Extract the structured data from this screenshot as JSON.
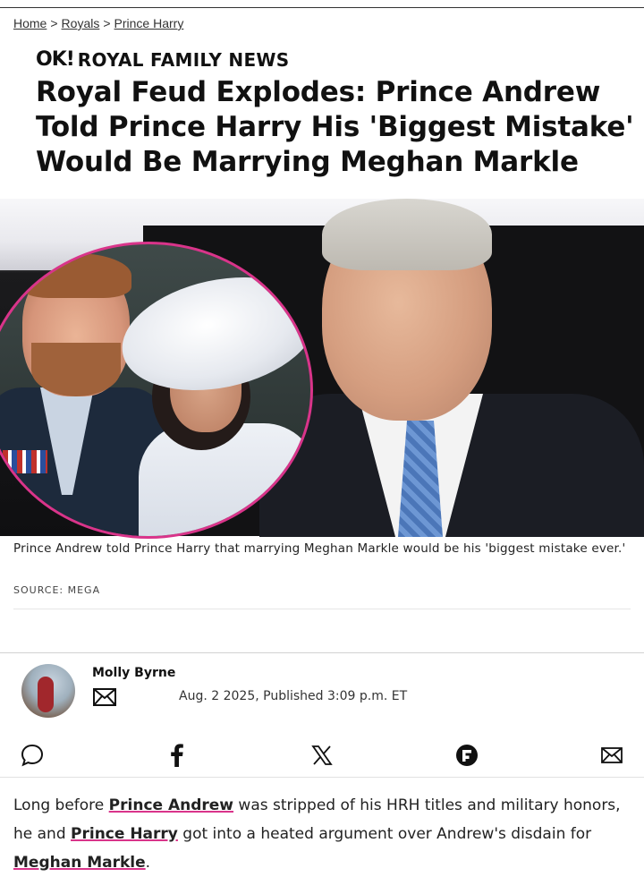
{
  "breadcrumb": {
    "home": "Home",
    "sep": ">",
    "royals": "Royals",
    "current": "Prince Harry"
  },
  "brand": {
    "logo": "OK!",
    "section": "ROYAL FAMILY NEWS"
  },
  "article": {
    "headline": "Royal Feud Explodes: Prince Andrew Told Prince Harry His 'Biggest Mistake' Would Be Marrying Meghan Markle",
    "caption": "Prince Andrew told Prince Harry that marrying Meghan Markle would be his 'biggest mistake ever.'",
    "source": "SOURCE: MEGA"
  },
  "author": {
    "name": "Molly Byrne",
    "published": "Aug. 2 2025, Published 3:09 p.m. ET"
  },
  "share_icons": [
    "comment-icon",
    "facebook-icon",
    "x-icon",
    "flipboard-icon",
    "email-icon"
  ],
  "body": {
    "p1_text1": "Long before ",
    "p1_link1": "Prince Andrew",
    "p1_text2": " was stripped of his HRH titles and military honors, he and ",
    "p1_link2": "Prince Harry",
    "p1_text3": " got into a heated argument over Andrew's disdain for ",
    "p1_link3": "Meghan Markle",
    "p1_text4": "."
  },
  "colors": {
    "accent": "#d9348a",
    "text": "#111111"
  }
}
